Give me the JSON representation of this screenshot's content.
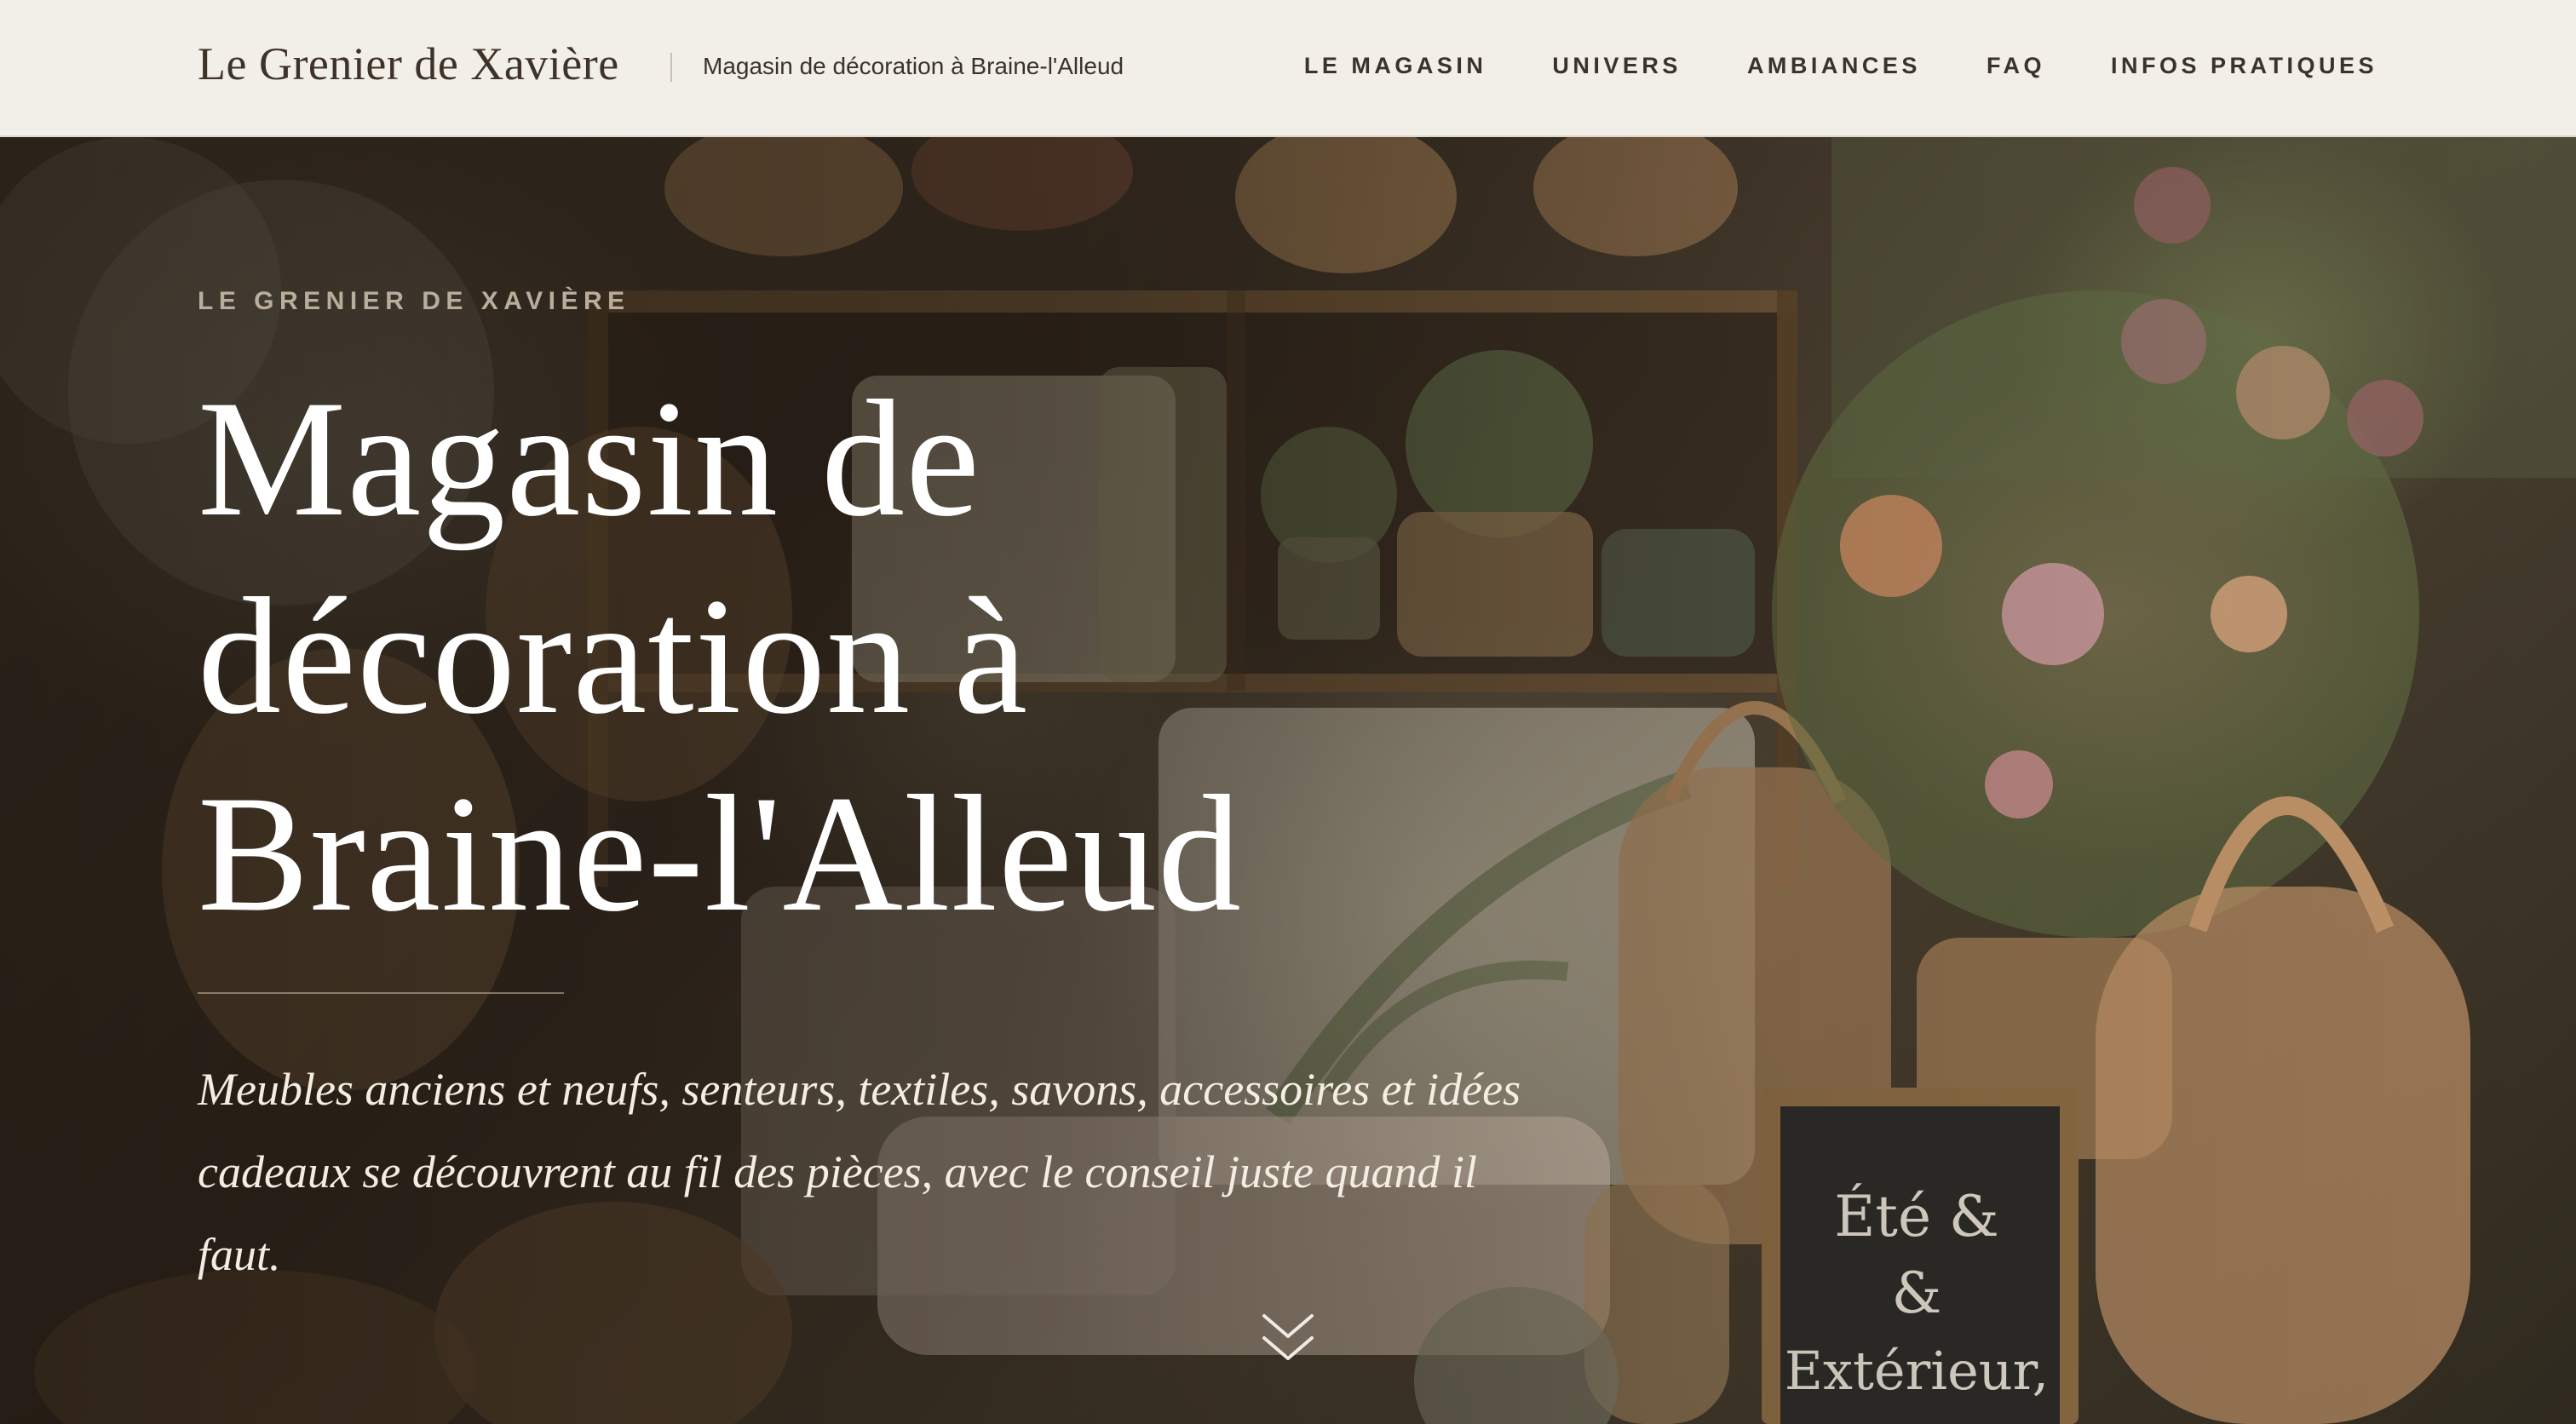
{
  "header": {
    "brand": "Le Grenier de Xavière",
    "tagline": "Magasin de décoration à Braine-l'Alleud",
    "nav": [
      {
        "label": "LE MAGASIN"
      },
      {
        "label": "UNIVERS"
      },
      {
        "label": "AMBIANCES"
      },
      {
        "label": "FAQ"
      },
      {
        "label": "INFOS PRATIQUES"
      }
    ]
  },
  "hero": {
    "eyebrow": "LE GRENIER DE XAVIÈRE",
    "title": "Magasin de décoration à Braine-l'Alleud",
    "description": "Meubles anciens et neufs, senteurs, textiles, savons, accessoires et idées cadeaux se découvrent au fil des pièces, avec le conseil juste quand il faut.",
    "sign_text": "Été & & Extérieur",
    "scroll_icon": "double-chevron-down-icon"
  },
  "colors": {
    "header_bg": "#f1efe8",
    "header_text": "#3b322b",
    "hero_text": "#ffffff",
    "eyebrow_text": "#b9ad9c"
  }
}
